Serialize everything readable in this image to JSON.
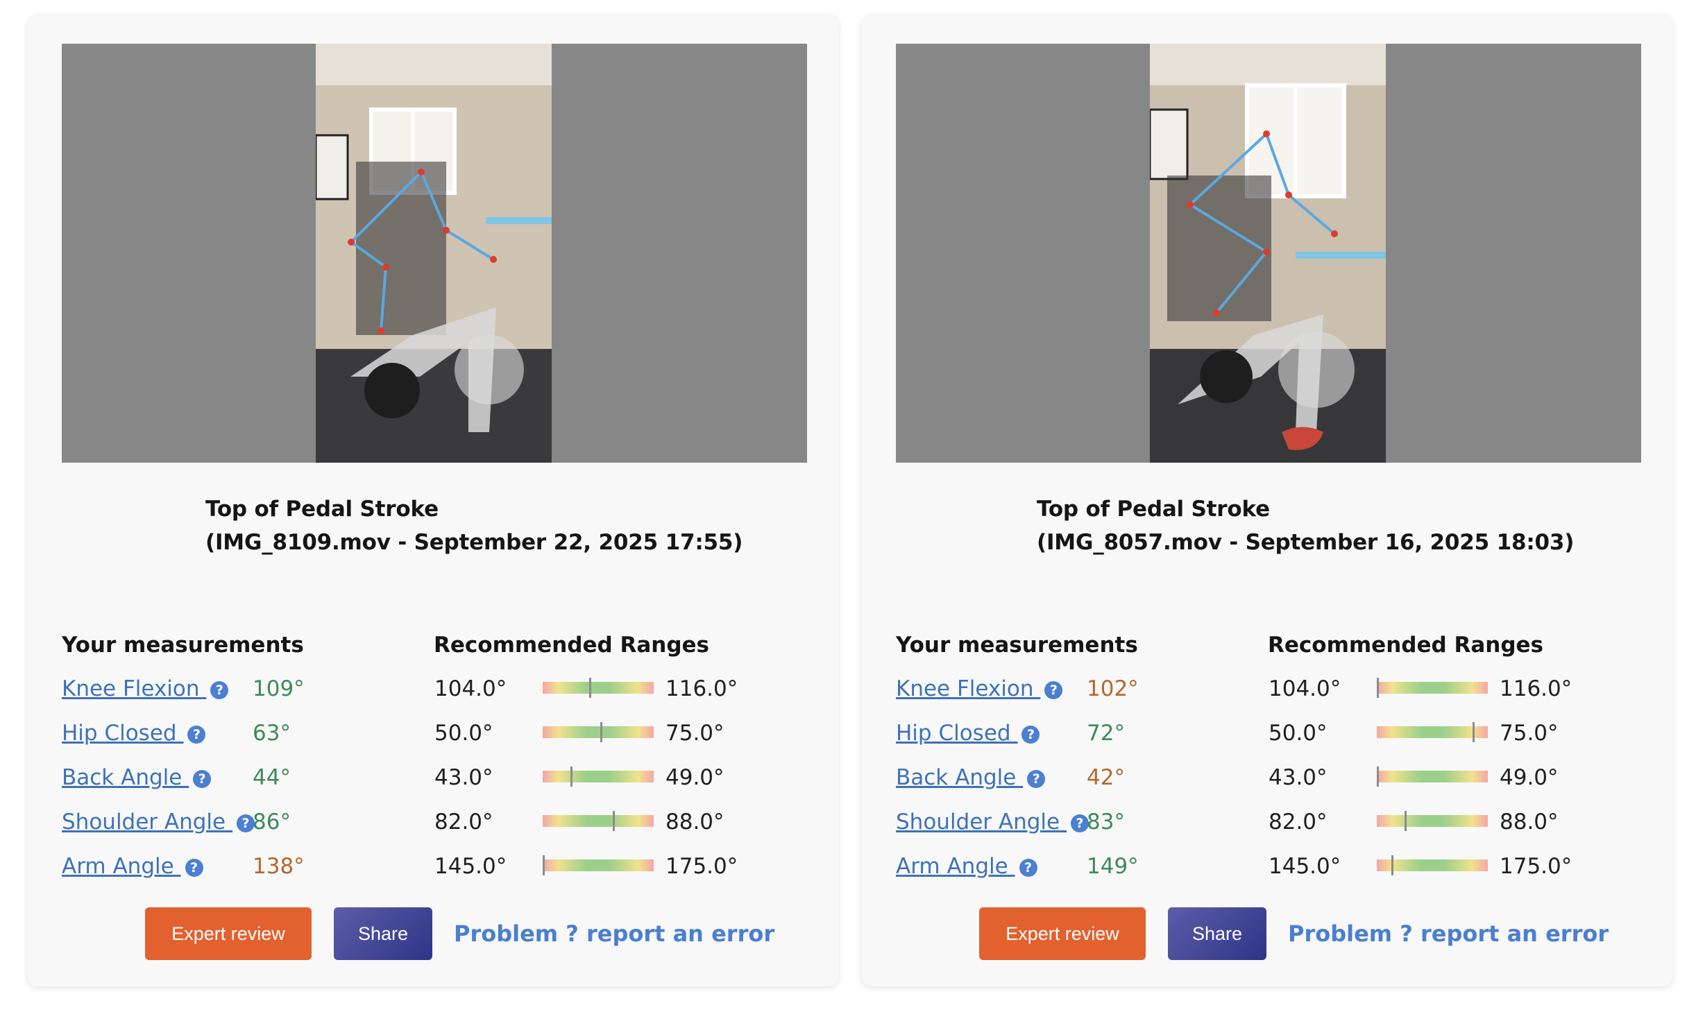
{
  "colors": {
    "good": "#3c8a58",
    "warn": "#b6672a",
    "link": "#3d72b8",
    "expert_button": "#e3612f",
    "share_button": "#3d3f94",
    "problem_link": "#4a7fd0"
  },
  "cards": [
    {
      "caption_line1": "Top of Pedal Stroke",
      "caption_line2": "(IMG_8109.mov - September 22, 2025 17:55)",
      "measurements_title": "Your measurements",
      "ranges_title": "Recommended Ranges",
      "help_icon": "?",
      "rows": [
        {
          "label": "Knee Flexion ",
          "value": "109°",
          "status": "good",
          "min": "104.0°",
          "max": "116.0°",
          "level": 0.42
        },
        {
          "label": "Hip Closed ",
          "value": "63°",
          "status": "good",
          "min": "50.0°",
          "max": "75.0°",
          "level": 0.52
        },
        {
          "label": "Back Angle ",
          "value": "44°",
          "status": "good",
          "min": "43.0°",
          "max": "49.0°",
          "level": 0.25
        },
        {
          "label": "Shoulder Angle ",
          "value": "86°",
          "status": "good",
          "min": "82.0°",
          "max": "88.0°",
          "level": 0.63
        },
        {
          "label": "Arm Angle ",
          "value": "138°",
          "status": "warn",
          "min": "145.0°",
          "max": "175.0°",
          "level": 0.0
        }
      ],
      "expert_label": "Expert review",
      "share_label": "Share",
      "problem_label": "Problem ? report an error"
    },
    {
      "caption_line1": "Top of Pedal Stroke",
      "caption_line2": "(IMG_8057.mov - September 16, 2025 18:03)",
      "measurements_title": "Your measurements",
      "ranges_title": "Recommended Ranges",
      "help_icon": "?",
      "rows": [
        {
          "label": "Knee Flexion ",
          "value": "102°",
          "status": "warn",
          "min": "104.0°",
          "max": "116.0°",
          "level": 0.0
        },
        {
          "label": "Hip Closed ",
          "value": "72°",
          "status": "good",
          "min": "50.0°",
          "max": "75.0°",
          "level": 0.86
        },
        {
          "label": "Back Angle ",
          "value": "42°",
          "status": "warn",
          "min": "43.0°",
          "max": "49.0°",
          "level": 0.0
        },
        {
          "label": "Shoulder Angle ",
          "value": "83°",
          "status": "good",
          "min": "82.0°",
          "max": "88.0°",
          "level": 0.25
        },
        {
          "label": "Arm Angle ",
          "value": "149°",
          "status": "good",
          "min": "145.0°",
          "max": "175.0°",
          "level": 0.13
        }
      ],
      "expert_label": "Expert review",
      "share_label": "Share",
      "problem_label": "Problem ? report an error"
    }
  ]
}
